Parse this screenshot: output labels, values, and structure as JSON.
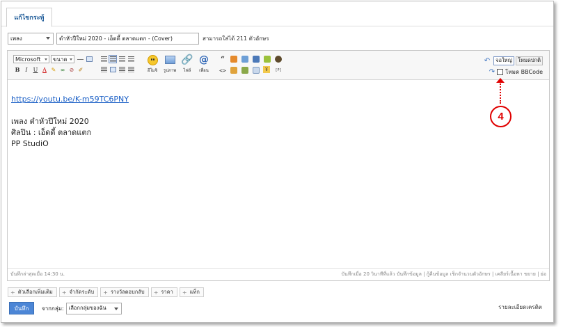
{
  "tab": {
    "label": "แก้ไขกระทู้"
  },
  "title_row": {
    "prefix": "เพลง",
    "title_value": "ตำหัวปีใหม่ 2020 - เอ็ดดี้ ตลาดแตก - (Cover)",
    "char_limit": "สามารถใส่ได้ 211 ตัวอักษร"
  },
  "toolbar": {
    "font_combo": "Microsoft",
    "size_combo": "ขนาด",
    "smilies_label": "อีโมจิ",
    "image_label": "รูปภาพ",
    "file_label": "ไฟล์",
    "mention_label": "เพื่อน",
    "full_editor_label": "จอใหญ่",
    "normal_mode_label": "โหมดปกติ",
    "bbcode_label": "โหมด BBCode"
  },
  "content": {
    "link": "https://youtu.be/K-m59TC6PNY",
    "line1": "เพลง   ตำหัวปีใหม่ 2020",
    "line2": "ศิลปิน : เอ็ดดี้ ตลาดแตก",
    "line3": "PP StudiO"
  },
  "statusbar": {
    "saved": "บันทึกล่าสุดเมื่อ 14:30 น.",
    "right": "บันทึกเมื่อ 20 วินาทีที่แล้ว บันทึกข้อมูล | กู้คืนข้อมูล    เช็กจำนวนตัวอักษร | เคลียร์เนื้อหา    ขยาย | ย่อ"
  },
  "tags": [
    {
      "label": "ตัวเลือกเพิ่มเติม"
    },
    {
      "label": "จำกัดระดับ"
    },
    {
      "label": "รางวัลตอบกลับ"
    },
    {
      "label": "ราคา"
    },
    {
      "label": "แท็ก"
    }
  ],
  "bottom": {
    "save_label": "บันทึก",
    "group_label": "จากกลุ่ม:",
    "group_select": "เลือกกลุ่มของฉัน",
    "detail_link": "รายละเอียดเครดิต"
  },
  "annotation": {
    "number": "4"
  },
  "colors": {
    "accent": "#4c86d6",
    "annotation": "#e00000",
    "link": "#1a5fc6"
  }
}
